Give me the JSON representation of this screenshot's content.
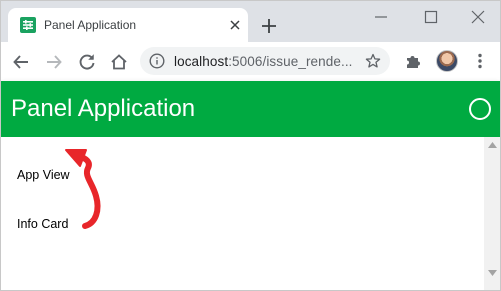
{
  "browser": {
    "tab": {
      "title": "Panel Application",
      "favicon": "panel-app-favicon-icon"
    },
    "window_controls": [
      "minimize-icon",
      "maximize-icon",
      "close-icon"
    ],
    "address": {
      "host": "localhost",
      "rest": ":5006/issue_rende..."
    },
    "toolbar_icons": [
      "back-arrow-icon",
      "forward-arrow-icon",
      "reload-icon",
      "home-icon",
      "site-info-icon",
      "bookmark-star-icon",
      "extensions-puzzle-icon",
      "profile-avatar",
      "menu-kebab-icon"
    ]
  },
  "app": {
    "title": "Panel Application",
    "header_color": "#00aa41",
    "busy_indicator": "busy-indicator-circle"
  },
  "sidebar": {
    "items": [
      {
        "label": "App View"
      },
      {
        "label": "Info Card"
      }
    ]
  },
  "annotation": {
    "shape": "red-curved-arrow",
    "color": "#e8262a"
  }
}
